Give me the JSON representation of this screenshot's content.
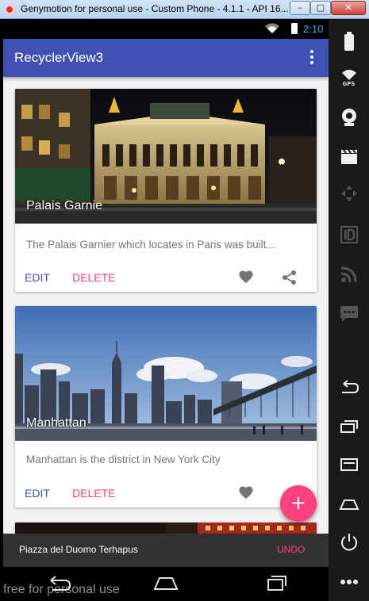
{
  "window": {
    "title": "Genymotion for personal use - Custom Phone - 4.1.1 - API 16...",
    "minimize_label": "–",
    "maximize_label": "□",
    "close_label": "✕"
  },
  "status_bar": {
    "time": "2:10",
    "time_color": "#33b5e5"
  },
  "app_bar": {
    "title": "RecyclerView3",
    "color": "#3f51b5"
  },
  "cards": [
    {
      "title": "Palais Garnie",
      "description": "The Palais Garnier which locates in Paris was built...",
      "edit_label": "EDIT",
      "delete_label": "DELETE"
    },
    {
      "title": "Manhattan",
      "description": "Manhattan is the district in New York City",
      "edit_label": "EDIT",
      "delete_label": "DELETE"
    }
  ],
  "fab": {
    "label": "+",
    "color": "#ff4081"
  },
  "snackbar": {
    "message": "Piazza del Duomo Terhapus",
    "action": "UNDO",
    "action_color": "#ff4081"
  },
  "watermark": "free for personal use",
  "side_toolbar": {
    "gps_label": "GPS",
    "items": [
      "battery-icon",
      "gps-icon",
      "camera-icon",
      "video-icon",
      "dpad-icon",
      "id-icon",
      "rss-icon",
      "sms-icon",
      "back-icon",
      "recent-apps-icon",
      "menu-icon",
      "home-icon",
      "power-icon",
      "more-icon"
    ]
  }
}
